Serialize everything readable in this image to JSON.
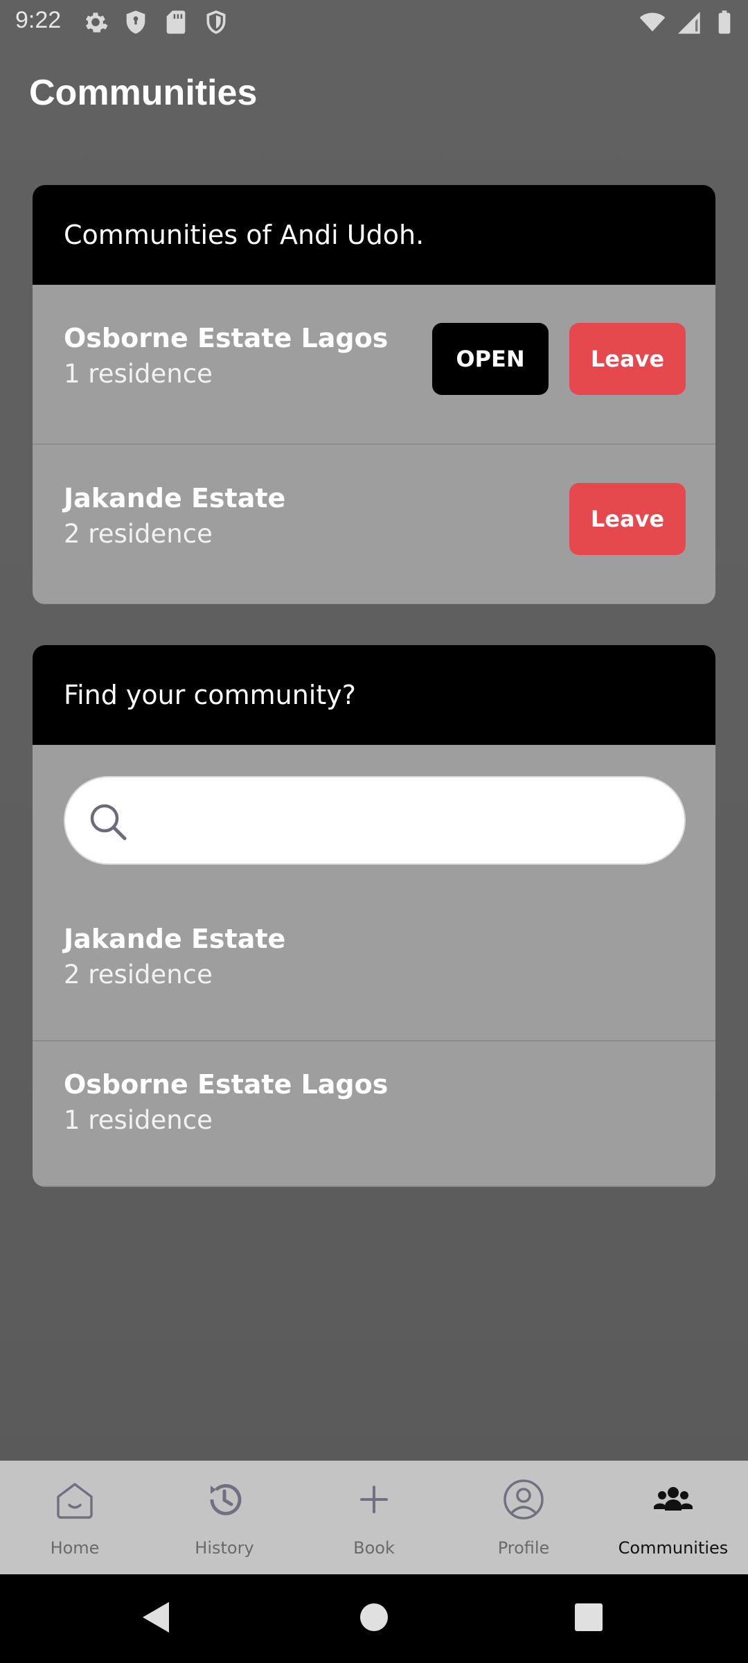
{
  "status_bar": {
    "time": "9:22",
    "left_icons": [
      "gear-icon",
      "shield-icon",
      "sd-card-icon",
      "shield-outline-icon"
    ],
    "right_icons": [
      "wifi-icon",
      "signal-icon",
      "battery-icon"
    ]
  },
  "page": {
    "title": "Communities"
  },
  "my_communities": {
    "header": "Communities of Andi Udoh.",
    "items": [
      {
        "name": "Osborne Estate Lagos",
        "sub": "1 residence",
        "open_label": "OPEN",
        "leave_label": "Leave"
      },
      {
        "name": "Jakande Estate",
        "sub": "2 residence",
        "leave_label": "Leave"
      }
    ]
  },
  "find_community": {
    "header": "Find your community?",
    "search": {
      "value": "",
      "placeholder": ""
    },
    "results": [
      {
        "name": "Jakande Estate",
        "sub": "2 residence"
      },
      {
        "name": "Osborne Estate Lagos",
        "sub": "1 residence"
      }
    ]
  },
  "bottom_nav": {
    "items": [
      {
        "label": "Home",
        "icon": "home-icon"
      },
      {
        "label": "History",
        "icon": "history-icon"
      },
      {
        "label": "Book",
        "icon": "plus-icon"
      },
      {
        "label": "Profile",
        "icon": "profile-icon"
      },
      {
        "label": "Communities",
        "icon": "communities-icon"
      }
    ],
    "active": "Communities"
  },
  "colors": {
    "leave_button": "#e5484d",
    "open_button": "#000000",
    "card_body": "#9e9e9e",
    "card_header": "#000000"
  }
}
